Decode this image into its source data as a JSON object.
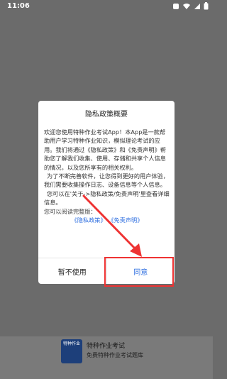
{
  "status_bar": {
    "time": "11:06",
    "icons": [
      "notification-icon",
      "wifi-icon",
      "signal-icon",
      "battery-icon"
    ]
  },
  "dialog": {
    "title": "隐私政策概要",
    "paragraphs": [
      "欢迎您使用特种作业考试App！本App是一款帮助用户学习特种作业知识，模拟理论考试的应用。我们将通过《隐私政策》和《免责声明》帮助您了解我们收集、使用、存储和共享个人信息的情况，以及您所享有的相关权利。",
      "为了不断完善软件，让您得到更好的用户体验，我们需要收集操作日志、设备信息等个人信息。",
      "您可以在'关于->隐私政策/免责声明'里查看详细信息。"
    ],
    "read_full": "您可以阅读完整版：",
    "link_privacy": "《隐私政策》",
    "link_disclaimer": "《免责声明》",
    "decline_label": "暂不使用",
    "agree_label": "同意"
  },
  "bottom": {
    "app_name": "特种作业考试",
    "app_desc": "免费特种作业考试题库",
    "icon_text": "特种作业"
  },
  "colors": {
    "accent": "#2f6fe0",
    "annotation": "#e33333"
  }
}
